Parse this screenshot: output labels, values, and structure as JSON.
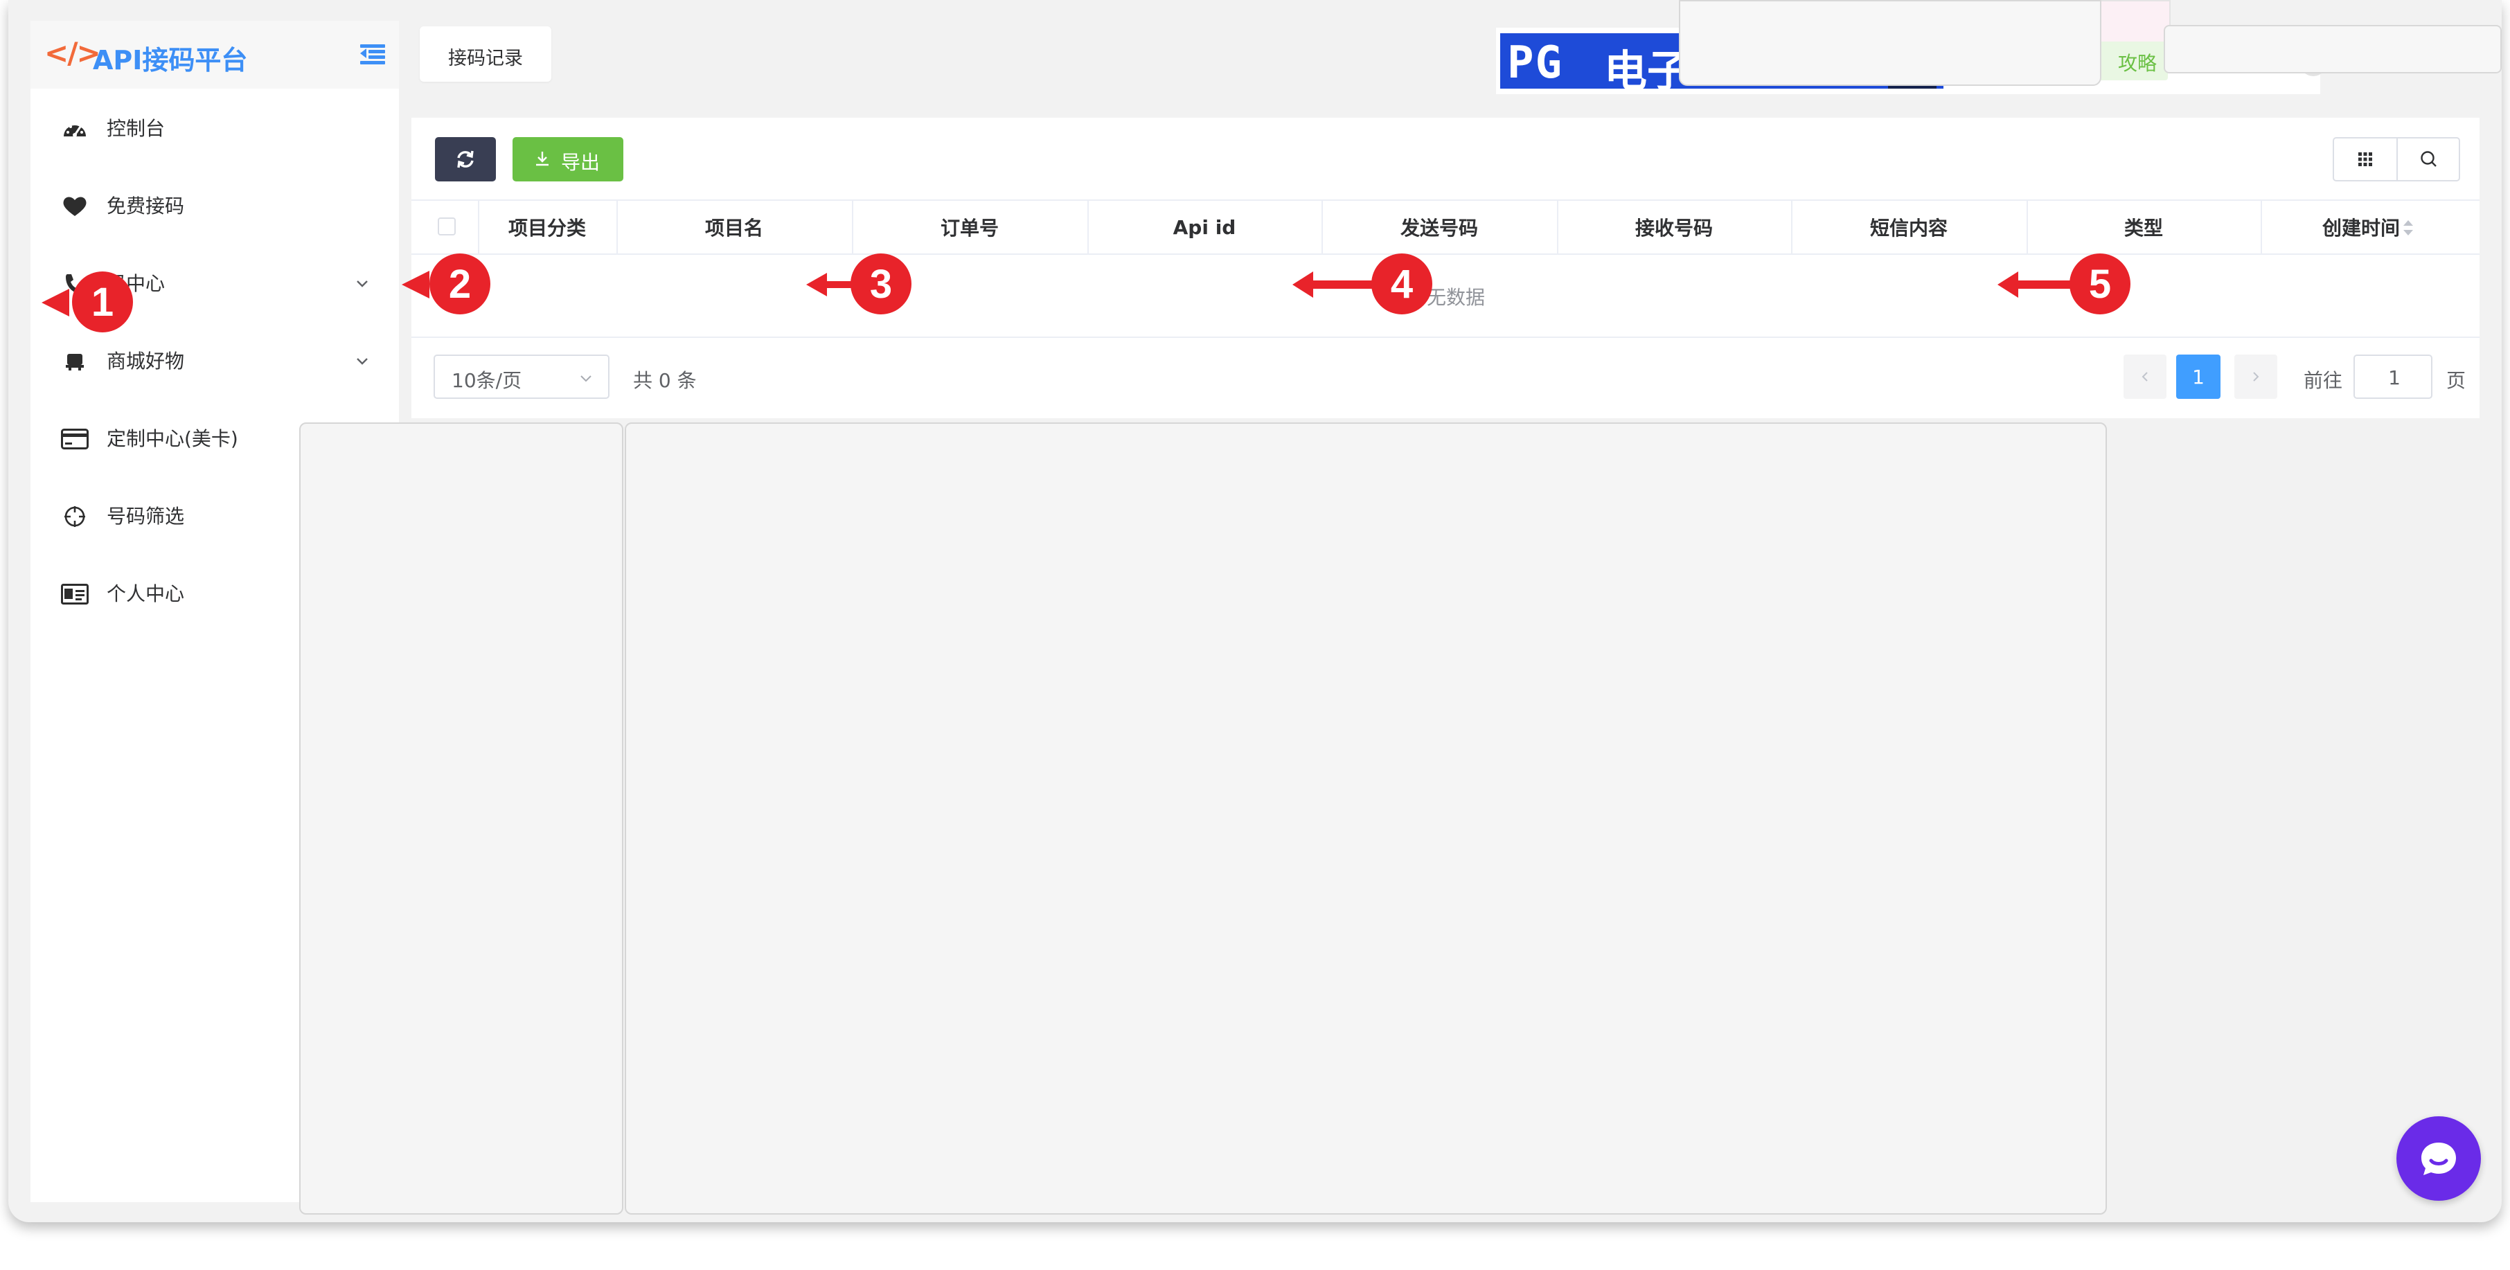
{
  "logo": {
    "code_glyph": "</>",
    "title": "API接码平台"
  },
  "sidebar": {
    "items": [
      {
        "label": "控制台",
        "icon": "dashboard-gauge-icon"
      },
      {
        "label": "免费接码",
        "icon": "heart-icon"
      },
      {
        "label": "码中心",
        "icon": "phone-icon",
        "has_submenu": true
      },
      {
        "label": "商城好物",
        "icon": "store-icon",
        "has_submenu": true
      },
      {
        "label": "定制中心(美卡)",
        "icon": "credit-card-icon"
      },
      {
        "label": "号码筛选",
        "icon": "crosshair-icon"
      },
      {
        "label": "个人中心",
        "icon": "id-card-icon"
      }
    ]
  },
  "tabs": [
    {
      "label": "接码记录"
    }
  ],
  "banner": {
    "pg_text": "PG",
    "cn_text": "电子",
    "pill_text": "攻略"
  },
  "toolbar": {
    "export_label": "导出"
  },
  "table": {
    "columns": [
      "项目分类",
      "项目名",
      "订单号",
      "Api id",
      "发送号码",
      "接收号码",
      "短信内容",
      "类型",
      "创建时间"
    ],
    "empty_text": "无数据"
  },
  "pagination": {
    "page_size": "10条/页",
    "total": "共 0 条",
    "current_page": "1",
    "goto_label": "前往",
    "goto_value": "1",
    "page_suffix": "页"
  },
  "annotations": [
    "1",
    "2",
    "3",
    "4",
    "5"
  ],
  "colors": {
    "brand_blue": "#3d8ff6",
    "logo_orange": "#f26a3a",
    "export_green": "#6ac044",
    "refresh_dark": "#393e53",
    "active_page": "#409eff",
    "annotation_red": "#e8232a",
    "chat_purple": "#6a2be8"
  }
}
